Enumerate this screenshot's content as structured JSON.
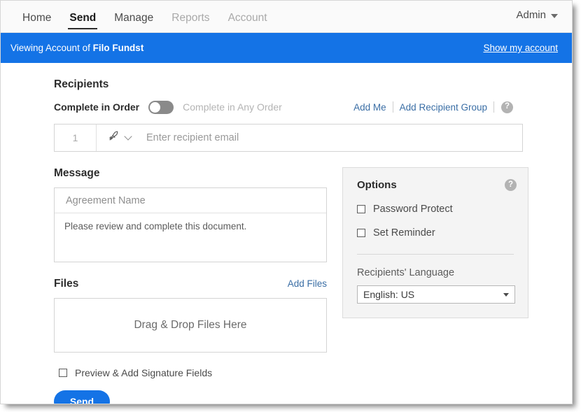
{
  "colors": {
    "brand_blue": "#1473e6",
    "link_blue": "#3a6ea5",
    "panel_gray": "#f4f4f4",
    "toggle_gray": "#8a8a8a"
  },
  "topnav": {
    "items": [
      {
        "label": "Home",
        "state": "normal"
      },
      {
        "label": "Send",
        "state": "active"
      },
      {
        "label": "Manage",
        "state": "normal"
      },
      {
        "label": "Reports",
        "state": "dim"
      },
      {
        "label": "Account",
        "state": "dim"
      }
    ],
    "user_menu_label": "Admin"
  },
  "banner": {
    "prefix": "Viewing Account of ",
    "account_name": "Filo Fundst",
    "link_label": "Show my account"
  },
  "recipients": {
    "title": "Recipients",
    "order_toggle": {
      "label_on": "Complete in Order",
      "label_off": "Complete in Any Order",
      "state": "complete-in-order"
    },
    "add_me_label": "Add Me",
    "add_group_label": "Add Recipient Group",
    "help_glyph": "?",
    "row": {
      "number": "1",
      "role_icon": "signature-pen-icon",
      "email_placeholder": "Enter recipient email",
      "email_value": ""
    }
  },
  "message": {
    "title": "Message",
    "agreement_name_placeholder": "Agreement Name",
    "agreement_name_value": "",
    "body_value": "Please review and complete this document."
  },
  "files": {
    "title": "Files",
    "add_files_label": "Add Files",
    "dropzone_label": "Drag & Drop Files Here"
  },
  "options": {
    "title": "Options",
    "help_glyph": "?",
    "checkboxes": [
      {
        "label": "Password Protect",
        "checked": false
      },
      {
        "label": "Set Reminder",
        "checked": false
      }
    ],
    "language_label": "Recipients' Language",
    "language_value": "English: US"
  },
  "bottom": {
    "preview_label": "Preview & Add Signature Fields",
    "preview_checked": false,
    "send_label": "Send"
  }
}
